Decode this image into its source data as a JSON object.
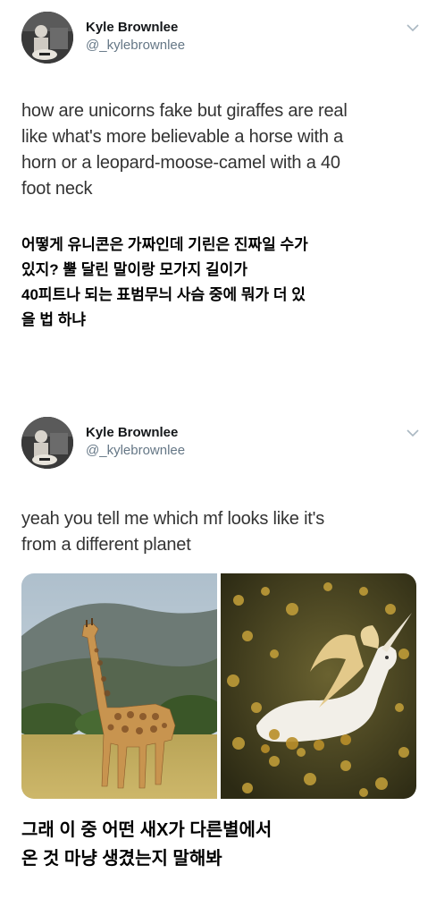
{
  "tweets": [
    {
      "author": {
        "name": "Kyle Brownlee",
        "handle": "@_kylebrownlee"
      },
      "text_lines": [
        "how are unicorns fake but giraffes are real",
        "like what's more believable a horse with a",
        "horn or a leopard-moose-camel with a 40",
        "foot neck"
      ]
    },
    {
      "author": {
        "name": "Kyle Brownlee",
        "handle": "@_kylebrownlee"
      },
      "text_lines": [
        "yeah you tell me which mf looks like it's",
        "from a different planet"
      ]
    }
  ],
  "captions": [
    {
      "lines": [
        "어떻게 유니콘은 가짜인데 기린은 진짜일 수가",
        "있지? 뿔 달린 말이랑 모가지 길이가",
        "40피트나 되는 표범무늬 사슴 중에 뭐가 더 있",
        "을 법 하냐"
      ]
    },
    {
      "lines": [
        "그래 이 중 어떤 새X가 다른별에서",
        "온 것 마냥 생겼는지 말해봐"
      ]
    }
  ],
  "icons": {
    "menu": "chevron-down-icon",
    "avatar": "profile-photo"
  },
  "colors": {
    "text": "#333333",
    "name": "#14171a",
    "handle": "#657786",
    "caption": "#000000",
    "background": "#ffffff"
  }
}
